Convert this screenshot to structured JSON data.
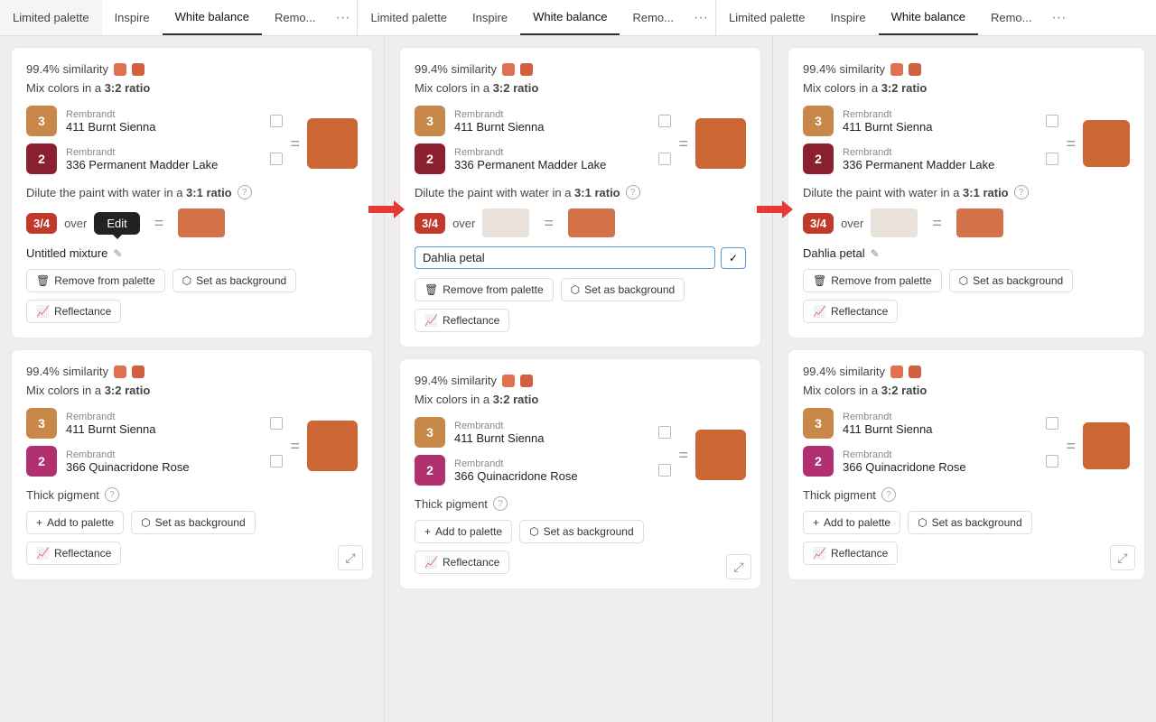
{
  "tabs": [
    {
      "groups": [
        {
          "items": [
            "Limited palette",
            "Inspire",
            "White balance",
            "Remo..."
          ],
          "hasMore": true
        },
        {
          "items": [
            "Limited palette",
            "Inspire",
            "White balance",
            "Remo..."
          ],
          "hasMore": true
        },
        {
          "items": [
            "Limited palette",
            "Inspire",
            "White balance",
            "Remo..."
          ],
          "hasMore": true
        }
      ]
    }
  ],
  "columns": [
    {
      "id": "col-1",
      "cards": [
        {
          "id": "card-1-1",
          "similarity": "99.4% similarity",
          "colors": [
            "#e07050",
            "#d06040"
          ],
          "mixRatio": "Mix colors in a 3:2 ratio",
          "paint1": {
            "badge": "3",
            "badgeColor": "#c8884a",
            "brand": "Rembrandt",
            "name": "411 Burnt Sienna"
          },
          "paint2": {
            "badge": "2",
            "badgeColor": "#8b2030",
            "brand": "Rembrandt",
            "name": "336 Permanent Madder Lake"
          },
          "resultColor": "#cc6633",
          "diluteText": "Dilute the paint with water in a",
          "diluteRatio": "3:1 ratio",
          "fraction": "3/4",
          "waterColor": "#e8e2db",
          "dilutedColor": "#d4734a",
          "mixtureName": "Untitled mixture",
          "showTooltip": true,
          "tooltipText": "Edit",
          "isEditing": false,
          "buttons": [
            "Remove from palette",
            "Set as background",
            "Reflectance"
          ]
        },
        {
          "id": "card-1-2",
          "similarity": "99.4% similarity",
          "colors": [
            "#e07050",
            "#d06040"
          ],
          "mixRatio": "Mix colors in a 3:2 ratio",
          "paint1": {
            "badge": "3",
            "badgeColor": "#c8884a",
            "brand": "Rembrandt",
            "name": "411 Burnt Sienna"
          },
          "paint2": {
            "badge": "2",
            "badgeColor": "#b03070",
            "brand": "Rembrandt",
            "name": "366 Quinacridone Rose"
          },
          "resultColor": "#cc6633",
          "diluteText": "Thick pigment",
          "diluteRatio": "",
          "fraction": "",
          "waterColor": "",
          "dilutedColor": "",
          "mixtureName": "",
          "showTooltip": false,
          "tooltipText": "",
          "isEditing": false,
          "buttons": [
            "Add to palette",
            "Set as background",
            "Reflectance"
          ]
        }
      ]
    },
    {
      "id": "col-2",
      "cards": [
        {
          "id": "card-2-1",
          "similarity": "99.4% similarity",
          "colors": [
            "#e07050",
            "#d06040"
          ],
          "mixRatio": "Mix colors in a 3:2 ratio",
          "paint1": {
            "badge": "3",
            "badgeColor": "#c8884a",
            "brand": "Rembrandt",
            "name": "411 Burnt Sienna"
          },
          "paint2": {
            "badge": "2",
            "badgeColor": "#8b2030",
            "brand": "Rembrandt",
            "name": "336 Permanent Madder Lake"
          },
          "resultColor": "#cc6633",
          "diluteText": "Dilute the paint with water in a",
          "diluteRatio": "3:1 ratio",
          "fraction": "3/4",
          "waterColor": "#e8e2db",
          "dilutedColor": "#d4734a",
          "mixtureName": "Dahlia petal",
          "showTooltip": false,
          "tooltipText": "",
          "isEditing": true,
          "buttons": [
            "Remove from palette",
            "Set as background",
            "Reflectance"
          ]
        },
        {
          "id": "card-2-2",
          "similarity": "99.4% similarity",
          "colors": [
            "#e07050",
            "#d06040"
          ],
          "mixRatio": "Mix colors in a 3:2 ratio",
          "paint1": {
            "badge": "3",
            "badgeColor": "#c8884a",
            "brand": "Rembrandt",
            "name": "411 Burnt Sienna"
          },
          "paint2": {
            "badge": "2",
            "badgeColor": "#b03070",
            "brand": "Rembrandt",
            "name": "366 Quinacridone Rose"
          },
          "resultColor": "#cc6633",
          "diluteText": "Thick pigment",
          "diluteRatio": "",
          "fraction": "",
          "waterColor": "",
          "dilutedColor": "",
          "mixtureName": "",
          "showTooltip": false,
          "tooltipText": "",
          "isEditing": false,
          "buttons": [
            "Add to palette",
            "Set as background",
            "Reflectance"
          ]
        }
      ]
    },
    {
      "id": "col-3",
      "cards": [
        {
          "id": "card-3-1",
          "similarity": "99.4% similarity",
          "colors": [
            "#e07050",
            "#d06040"
          ],
          "mixRatio": "Mix colors in a 3:2 ratio",
          "paint1": {
            "badge": "3",
            "badgeColor": "#c8884a",
            "brand": "Rembrandt",
            "name": "411 Burnt Sienna"
          },
          "paint2": {
            "badge": "2",
            "badgeColor": "#8b2030",
            "brand": "Rembrandt",
            "name": "336 Permanent Madder Lake"
          },
          "resultColor": "#cc6633",
          "diluteText": "Dilute the paint with water in a",
          "diluteRatio": "3:1 ratio",
          "fraction": "3/4",
          "waterColor": "#e8e2db",
          "dilutedColor": "#d4734a",
          "mixtureName": "Dahlia petal",
          "showTooltip": false,
          "tooltipText": "",
          "isEditing": false,
          "buttons": [
            "Remove from palette",
            "Set as background",
            "Reflectance"
          ]
        },
        {
          "id": "card-3-2",
          "similarity": "99.4% similarity",
          "colors": [
            "#e07050",
            "#d06040"
          ],
          "mixRatio": "Mix colors in a 3:2 ratio",
          "paint1": {
            "badge": "3",
            "badgeColor": "#c8884a",
            "brand": "Rembrandt",
            "name": "411 Burnt Sienna"
          },
          "paint2": {
            "badge": "2",
            "badgeColor": "#b03070",
            "brand": "Rembrandt",
            "name": "366 Quinacridone Rose"
          },
          "resultColor": "#cc6633",
          "diluteText": "Thick pigment",
          "diluteRatio": "",
          "fraction": "",
          "waterColor": "",
          "dilutedColor": "",
          "mixtureName": "",
          "showTooltip": false,
          "tooltipText": "",
          "isEditing": false,
          "buttons": [
            "Add to palette",
            "Set as background",
            "Reflectance"
          ]
        }
      ]
    }
  ],
  "labels": {
    "over": "over",
    "equals": "=",
    "thickPigment": "Thick pigment",
    "removeFromPalette": "Remove from palette",
    "setAsBackground": "Set as background",
    "addToPalette": "+ Add to palette",
    "reflectance": "Reflectance",
    "editTooltip": "Edit",
    "dahliaInputValue": "Dahlia petal",
    "pencilEdit": "✏"
  }
}
